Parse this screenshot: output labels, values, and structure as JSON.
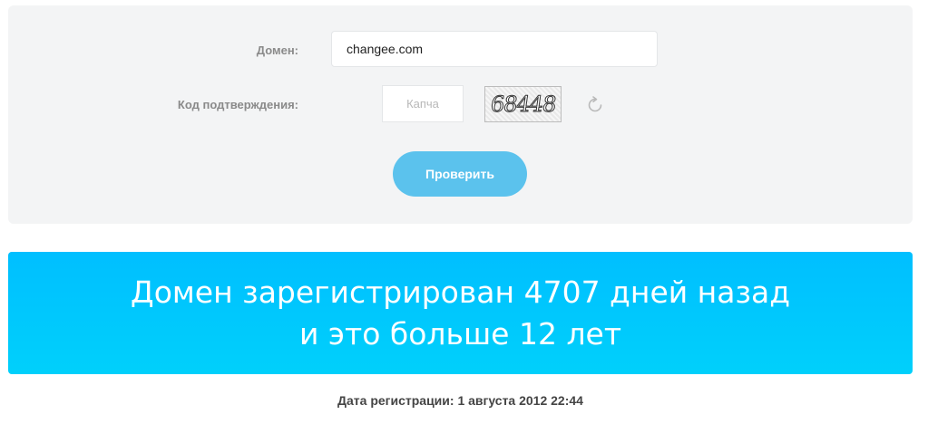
{
  "form": {
    "domain_label": "Домен:",
    "domain_value": "changee.com",
    "code_label": "Код подтверждения:",
    "captcha_placeholder": "Капча",
    "captcha_image_text": "68448",
    "refresh_icon": "refresh-icon",
    "submit_label": "Проверить"
  },
  "result": {
    "line1": "Домен зарегистрирован 4707 дней назад",
    "line2": "и это больше 12 лет"
  },
  "registration": {
    "text": "Дата регистрации: 1 августа 2012 22:44"
  },
  "colors": {
    "panel_bg": "#f3f4f5",
    "button": "#5bc2ed",
    "banner": "#00c6ff"
  }
}
